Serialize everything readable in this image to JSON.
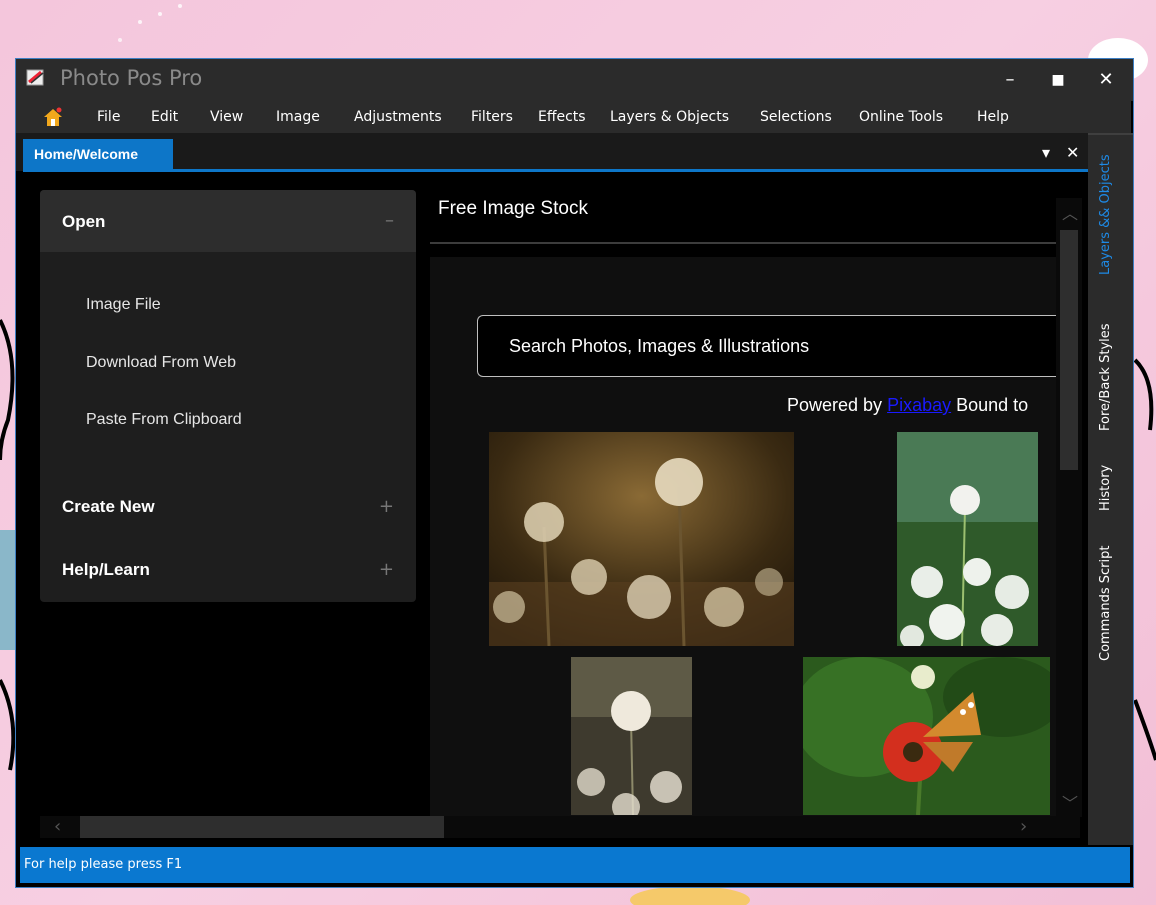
{
  "window": {
    "title": "Photo Pos Pro",
    "controls": {
      "minimize": "–",
      "maximize": "■",
      "close": "✕"
    }
  },
  "menu": [
    "File",
    "Edit",
    "View",
    "Image",
    "Adjustments",
    "Filters",
    "Effects",
    "Layers & Objects",
    "Selections",
    "Online Tools",
    "Help"
  ],
  "tabs": {
    "active": "Home/Welcome",
    "dropdown": "▾",
    "close": "✕"
  },
  "right_tabs": [
    "Layers && Objects",
    "Fore/Back Styles",
    "History",
    "Commands Script"
  ],
  "sidebar": {
    "open": {
      "label": "Open",
      "toggle": "–",
      "items": [
        "Image File",
        "Download From Web",
        "Paste From Clipboard"
      ]
    },
    "create_new": {
      "label": "Create New",
      "toggle": "+"
    },
    "help_learn": {
      "label": "Help/Learn",
      "toggle": "+"
    }
  },
  "content": {
    "title": "Free Image Stock",
    "search_placeholder": "Search Photos, Images & Illustrations",
    "powered_prefix": "Powered by ",
    "powered_link": "Pixabay",
    "powered_suffix": " Bound to"
  },
  "photos": [
    "dandelion-field-photo",
    "dandelion-meadow-photo",
    "single-dandelion-photo",
    "butterfly-flower-photo"
  ],
  "status": {
    "text": "For help please press F1"
  },
  "colors": {
    "accent": "#0d76c8",
    "status_bar": "#0a78d0",
    "title_bar": "#2b2b2b",
    "link": "#1a1aff"
  }
}
